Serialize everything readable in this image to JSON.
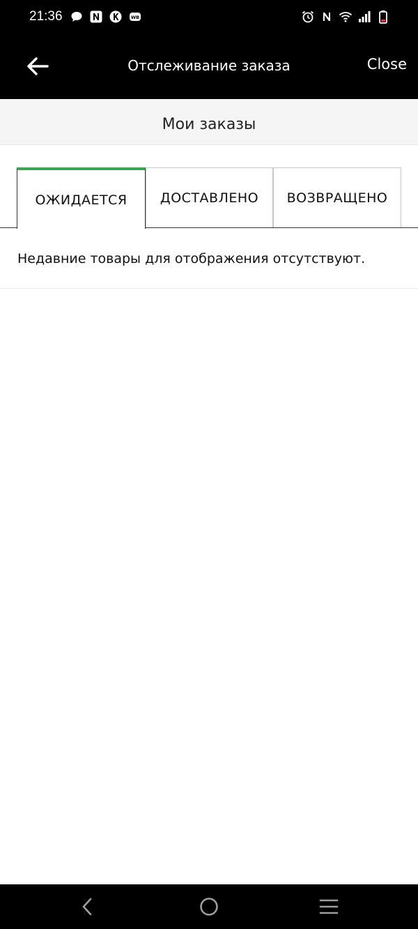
{
  "status_bar": {
    "time": "21:36",
    "left_icons": [
      "chat-bubble-icon",
      "n-square-icon",
      "k-circle-icon",
      "wb-badge-icon"
    ],
    "right_icons": [
      "alarm-icon",
      "nfc-icon",
      "wifi-icon",
      "cell-signal-icon",
      "battery-low-icon"
    ]
  },
  "app_bar": {
    "title": "Отслеживание заказа",
    "close_label": "Close",
    "back_icon": "arrow-left-icon"
  },
  "section": {
    "title": "Мои заказы"
  },
  "tabs": [
    {
      "label": "ОЖИДАЕТСЯ",
      "active": true
    },
    {
      "label": "ДОСТАВЛЕНО",
      "active": false
    },
    {
      "label": "ВОЗВРАЩЕНО",
      "active": false
    }
  ],
  "content": {
    "empty_message": "Недавние товары для отображения отсутствуют."
  },
  "nav_bar": {
    "icons": [
      "back-chevron-icon",
      "home-circle-icon",
      "menu-lines-icon"
    ]
  },
  "colors": {
    "bar_background": "#000000",
    "active_tab_accent": "#3aa757",
    "header_background": "#f5f5f5"
  }
}
